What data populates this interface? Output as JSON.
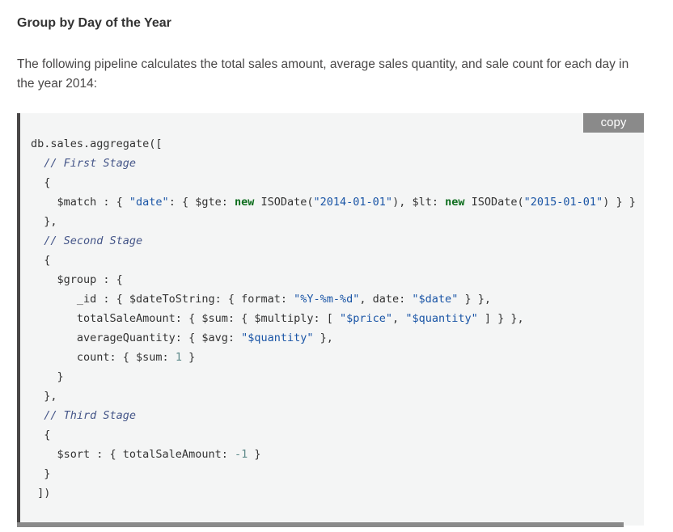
{
  "section": {
    "heading": "Group by Day of the Year",
    "description": "The following pipeline calculates the total sales amount, average sales quantity, and sale count for each day in the year 2014:"
  },
  "code_block": {
    "copy_label": "copy",
    "lines": [
      [
        {
          "t": "db.sales.aggregate(["
        }
      ],
      [
        {
          "t": "  "
        },
        {
          "t": "// First Stage",
          "c": "c"
        }
      ],
      [
        {
          "t": "  {"
        }
      ],
      [
        {
          "t": "    $match : { "
        },
        {
          "t": "\"date\"",
          "c": "s"
        },
        {
          "t": ": { $gte: "
        },
        {
          "t": "new",
          "c": "k"
        },
        {
          "t": " ISODate("
        },
        {
          "t": "\"2014-01-01\"",
          "c": "s"
        },
        {
          "t": "), $lt: "
        },
        {
          "t": "new",
          "c": "k"
        },
        {
          "t": " ISODate("
        },
        {
          "t": "\"2015-01-01\"",
          "c": "s"
        },
        {
          "t": ") } }"
        }
      ],
      [
        {
          "t": "  },"
        }
      ],
      [
        {
          "t": "  "
        },
        {
          "t": "// Second Stage",
          "c": "c"
        }
      ],
      [
        {
          "t": "  {"
        }
      ],
      [
        {
          "t": "    $group : {"
        }
      ],
      [
        {
          "t": "       _id : { $dateToString: { format: "
        },
        {
          "t": "\"%Y-%m-%d\"",
          "c": "s"
        },
        {
          "t": ", date: "
        },
        {
          "t": "\"$date\"",
          "c": "s"
        },
        {
          "t": " } },"
        }
      ],
      [
        {
          "t": "       totalSaleAmount: { $sum: { $multiply: [ "
        },
        {
          "t": "\"$price\"",
          "c": "s"
        },
        {
          "t": ", "
        },
        {
          "t": "\"$quantity\"",
          "c": "s"
        },
        {
          "t": " ] } },"
        }
      ],
      [
        {
          "t": "       averageQuantity: { $avg: "
        },
        {
          "t": "\"$quantity\"",
          "c": "s"
        },
        {
          "t": " },"
        }
      ],
      [
        {
          "t": "       count: { $sum: "
        },
        {
          "t": "1",
          "c": "n"
        },
        {
          "t": " }"
        }
      ],
      [
        {
          "t": "    }"
        }
      ],
      [
        {
          "t": "  },"
        }
      ],
      [
        {
          "t": "  "
        },
        {
          "t": "// Third Stage",
          "c": "c"
        }
      ],
      [
        {
          "t": "  {"
        }
      ],
      [
        {
          "t": "    $sort : { totalSaleAmount: "
        },
        {
          "t": "-1",
          "c": "n"
        },
        {
          "t": " }"
        }
      ],
      [
        {
          "t": "  }"
        }
      ],
      [
        {
          "t": " ])"
        }
      ]
    ]
  }
}
